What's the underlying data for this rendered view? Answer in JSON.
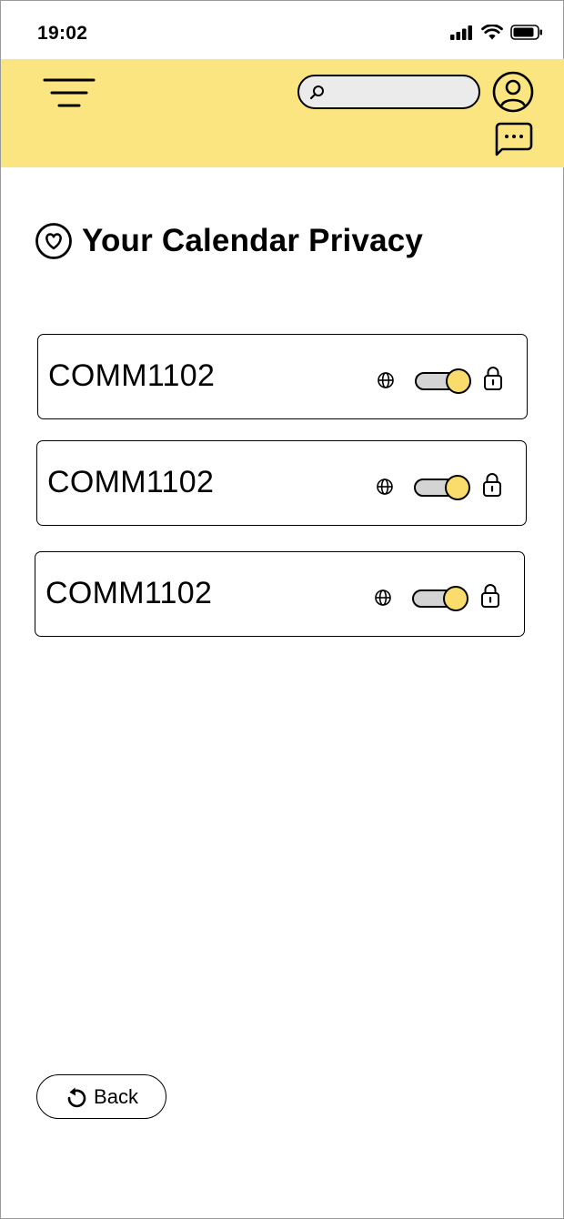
{
  "status_bar": {
    "time": "19:02",
    "icons": [
      "signal-icon",
      "wifi-icon",
      "battery-icon"
    ]
  },
  "header": {
    "background_color": "#fbe580",
    "menu_icon": "menu-icon",
    "search": {
      "placeholder": "",
      "value": ""
    },
    "profile_icon": "user-icon",
    "chat_icon": "chat-icon"
  },
  "page": {
    "title_icon": "heart-circle-icon",
    "title": "Your Calendar Privacy"
  },
  "calendars": [
    {
      "label": "COMM1102",
      "public_icon": "globe-icon",
      "private_icon": "lock-icon",
      "toggle_on": true
    },
    {
      "label": "COMM1102",
      "public_icon": "globe-icon",
      "private_icon": "lock-icon",
      "toggle_on": true
    },
    {
      "label": "COMM1102",
      "public_icon": "globe-icon",
      "private_icon": "lock-icon",
      "toggle_on": true
    }
  ],
  "back_button": {
    "label": "Back",
    "icon": "undo-icon"
  },
  "colors": {
    "accent": "#f9dc6b",
    "toggle_track": "#d4d4d4",
    "search_fill": "#ebebeb"
  }
}
